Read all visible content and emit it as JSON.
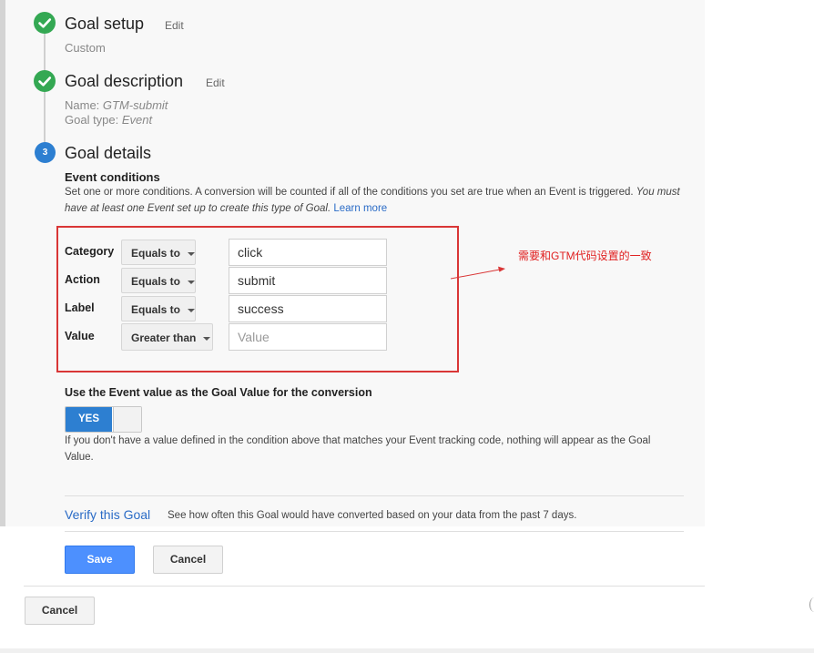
{
  "steps": [
    {
      "title": "Goal setup",
      "edit": "Edit",
      "detail": "Custom"
    },
    {
      "title": "Goal description",
      "edit": "Edit",
      "name_label": "Name:",
      "name_value": "GTM-submit",
      "type_label": "Goal type:",
      "type_value": "Event"
    },
    {
      "number": "3",
      "title": "Goal details"
    }
  ],
  "event_conditions": {
    "heading": "Event conditions",
    "description": "Set one or more conditions. A conversion will be counted if all of the conditions you set are true when an Event is triggered.",
    "description_italic": "You must have at least one Event set up to create this type of Goal.",
    "learn_more": "Learn more",
    "rows": [
      {
        "label": "Category",
        "operator": "Equals to",
        "value": "click",
        "placeholder": ""
      },
      {
        "label": "Action",
        "operator": "Equals to",
        "value": "submit",
        "placeholder": ""
      },
      {
        "label": "Label",
        "operator": "Equals to",
        "value": "success",
        "placeholder": ""
      },
      {
        "label": "Value",
        "operator": "Greater than",
        "value": "",
        "placeholder": "Value"
      }
    ]
  },
  "annotation": {
    "note": "需要和GTM代码设置的一致",
    "color": "#d93636"
  },
  "goal_value": {
    "heading": "Use the Event value as the Goal Value for the conversion",
    "toggle_label": "YES",
    "help": "If you don't have a value defined in the condition above that matches your Event tracking code, nothing will appear as the Goal Value."
  },
  "verify": {
    "link": "Verify this Goal",
    "description": "See how often this Goal would have converted based on your data from the past 7 days."
  },
  "actions": {
    "save": "Save",
    "cancel": "Cancel",
    "outer_cancel": "Cancel"
  },
  "colors": {
    "accent": "#2d7fd1",
    "success": "#34a853",
    "primary_button": "#4d90fe"
  },
  "icons": [
    "check-icon",
    "check-icon",
    "step-number-badge",
    "caret-down-icon",
    "arrow-annotation"
  ]
}
